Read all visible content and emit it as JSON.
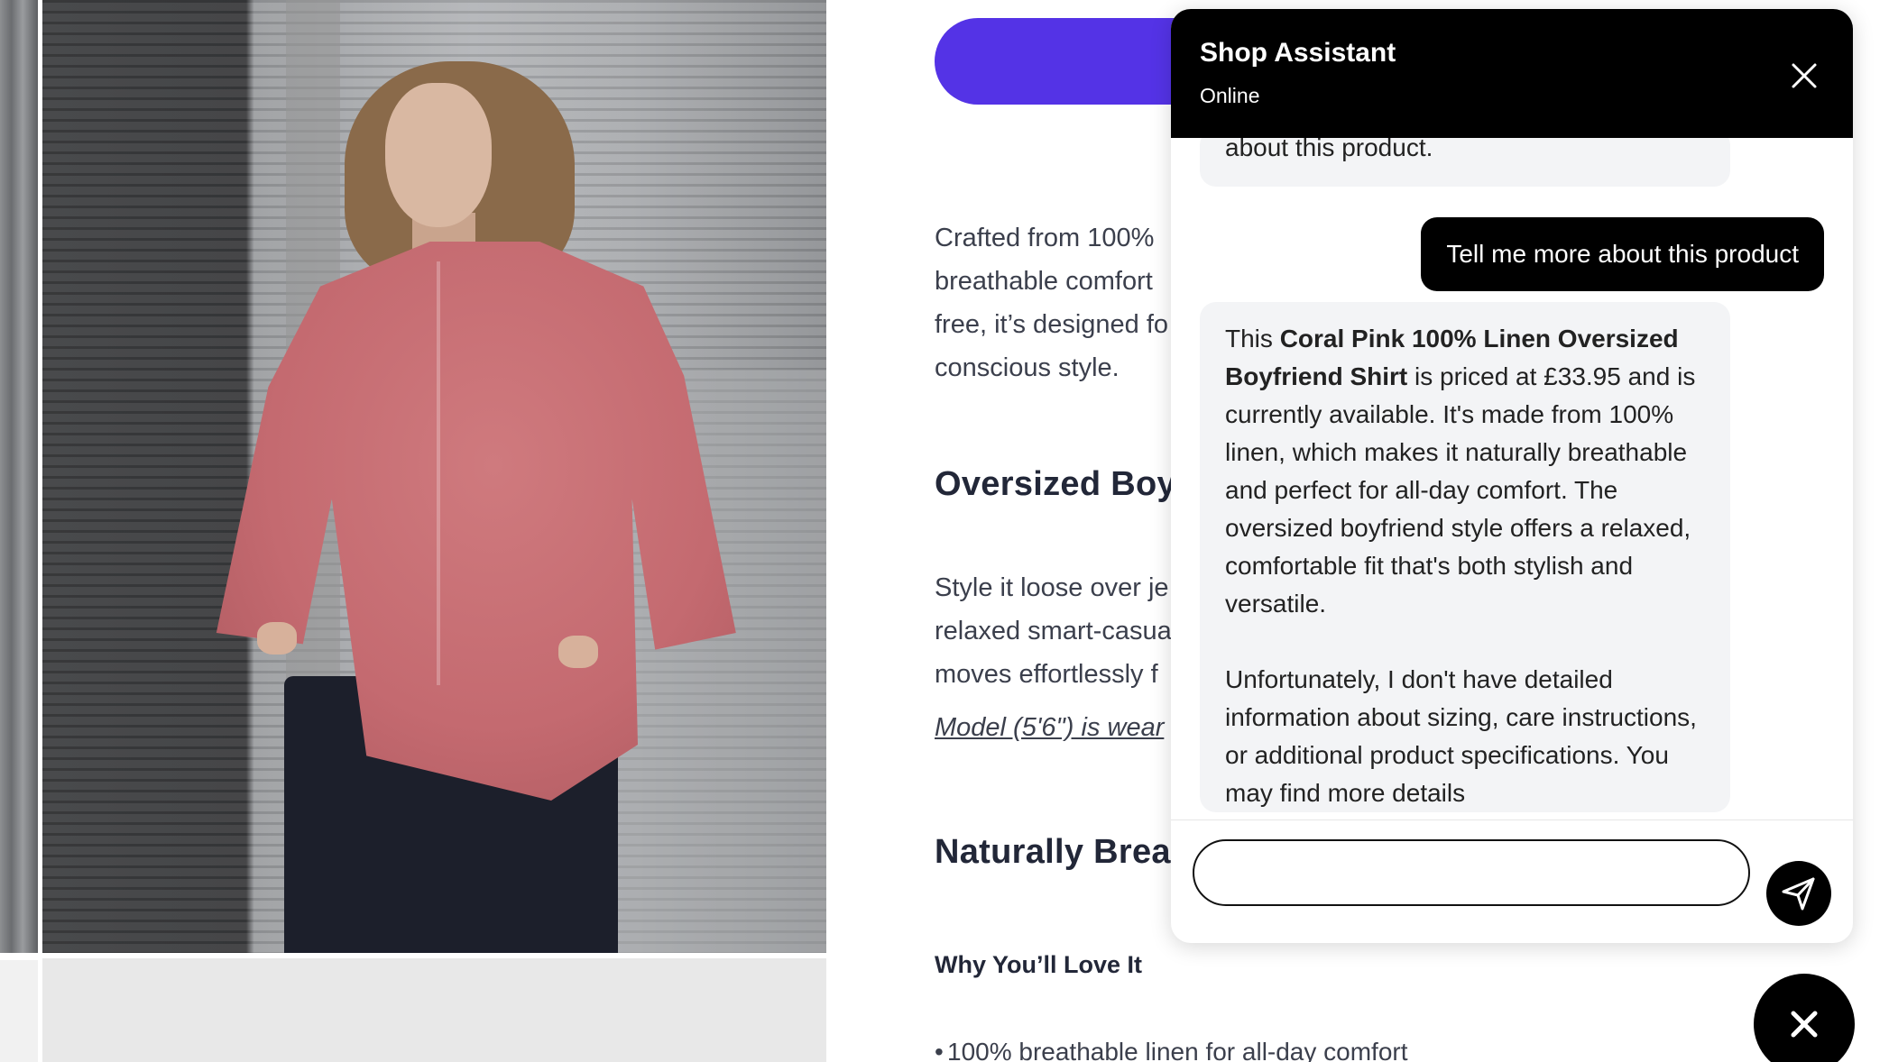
{
  "product": {
    "intro_lines": [
      "Crafted from 100%",
      "breathable comfort",
      "free, it’s designed fo",
      "conscious style."
    ],
    "heading_style": "Oversized Boy",
    "style_lines": [
      "Style it loose over je",
      "relaxed smart-casua",
      "moves effortlessly f"
    ],
    "model_note": "Model (5'6\") is wear",
    "heading_breathable": "Naturally Brea",
    "why_love_heading": "Why You’ll Love It",
    "bullets": [
      "100% breathable linen for all-day comfort"
    ]
  },
  "chat": {
    "title": "Shop Assistant",
    "status": "Online",
    "messages": {
      "prev_bot_tail": "about this product.",
      "user_1": "Tell me more about this product",
      "bot_1": {
        "intro": "This ",
        "product_name": "Coral Pink 100% Linen Oversized Boyfriend Shirt",
        "details": " is priced at £33.95 and is currently available. It's made from 100% linen, which makes it naturally breathable and perfect for all-day comfort. The oversized boyfriend style offers a relaxed, comfortable fit that's both stylish and versatile.",
        "paragraph_2": "Unfortunately, I don't have detailed information about sizing, care instructions, or additional product specifications. You may find more details"
      }
    },
    "input_value": "",
    "input_placeholder": ""
  },
  "icons": {
    "header_close": "close-icon",
    "send": "send-icon",
    "launcher": "close-icon"
  },
  "colors": {
    "cta": "#5433e6",
    "chat_header": "#000000",
    "bot_bubble": "#f3f4f6",
    "user_bubble": "#000000",
    "shirt": "#c46a70"
  }
}
